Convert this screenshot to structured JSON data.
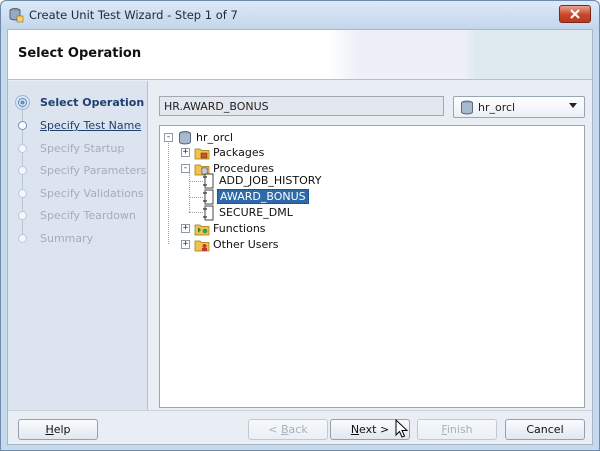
{
  "window": {
    "title": "Create Unit Test Wizard - Step 1 of 7"
  },
  "header": {
    "title": "Select Operation"
  },
  "steps": [
    {
      "label": "Select Operation",
      "state": "active"
    },
    {
      "label": "Specify Test Name",
      "state": "current-link"
    },
    {
      "label": "Specify Startup",
      "state": "disabled"
    },
    {
      "label": "Specify Parameters",
      "state": "disabled"
    },
    {
      "label": "Specify Validations",
      "state": "disabled"
    },
    {
      "label": "Specify Teardown",
      "state": "disabled"
    },
    {
      "label": "Summary",
      "state": "disabled"
    }
  ],
  "selection": {
    "path_value": "HR.AWARD_BONUS",
    "connection": "hr_orcl"
  },
  "tree": {
    "root": "hr_orcl",
    "nodes": [
      {
        "label": "Packages",
        "expanded": false,
        "icon": "package-folder-icon"
      },
      {
        "label": "Procedures",
        "expanded": true,
        "icon": "procedure-folder-icon",
        "children": [
          "ADD_JOB_HISTORY",
          "AWARD_BONUS",
          "SECURE_DML"
        ]
      },
      {
        "label": "Functions",
        "expanded": false,
        "icon": "function-folder-icon"
      },
      {
        "label": "Other Users",
        "expanded": false,
        "icon": "users-folder-icon"
      }
    ],
    "selected": "AWARD_BONUS"
  },
  "buttons": {
    "help": {
      "pre": "",
      "u": "H",
      "post": "elp"
    },
    "back": {
      "pre": "< ",
      "u": "B",
      "post": "ack"
    },
    "next": {
      "pre": "",
      "u": "N",
      "post": "ext >"
    },
    "finish": {
      "pre": "",
      "u": "F",
      "post": "inish"
    },
    "cancel": {
      "label": "Cancel"
    }
  },
  "colors": {
    "selection": "#2f6aa8",
    "active_step": "#1f3f6e",
    "close_button": "#c7462b"
  }
}
